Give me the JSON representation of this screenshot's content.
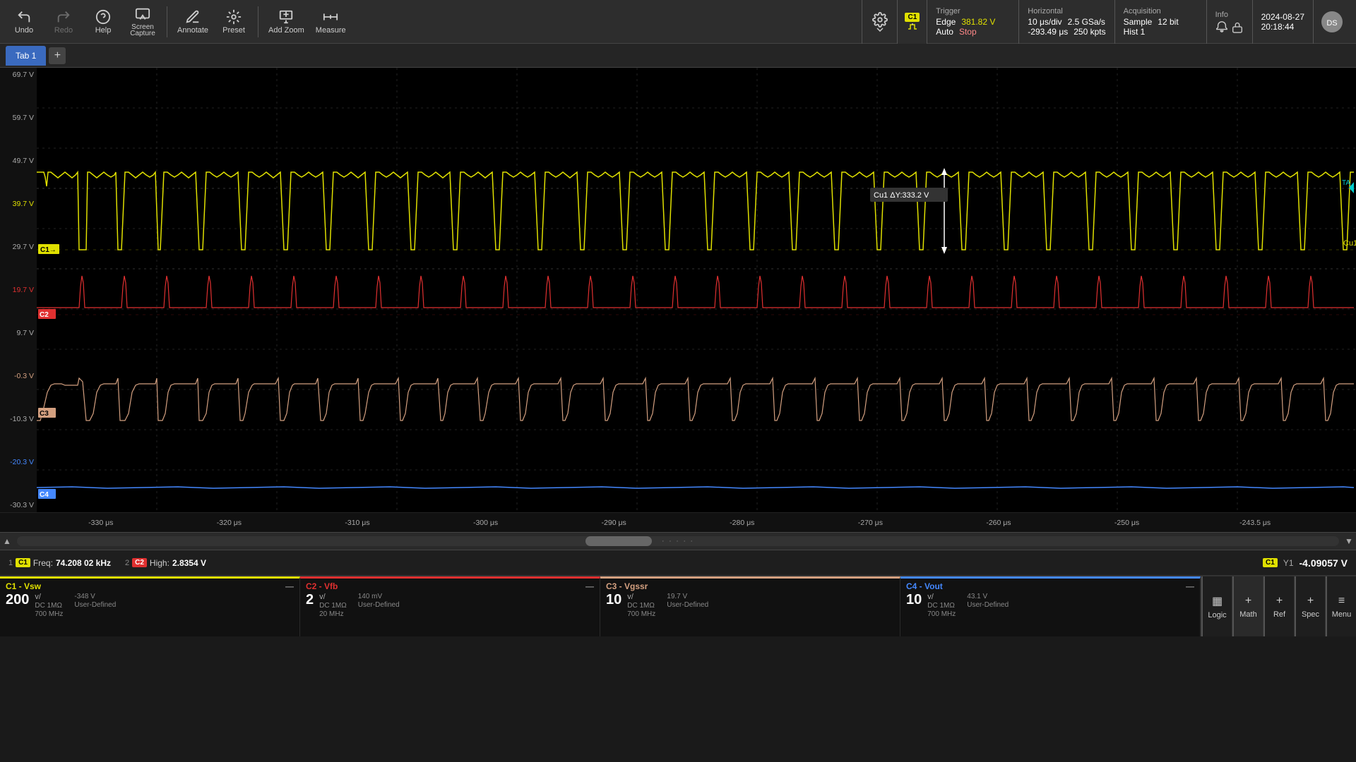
{
  "toolbar": {
    "undo_label": "Undo",
    "redo_label": "Redo",
    "help_label": "Help",
    "screen_capture_label": "Screen\nCapture",
    "annotate_label": "Annotate",
    "preset_label": "Preset",
    "add_zoom_label": "Add Zoom",
    "measure_label": "Measure"
  },
  "trigger": {
    "title": "Trigger",
    "type": "Edge",
    "level": "381.82 V",
    "mode": "Auto",
    "stop": "Stop"
  },
  "horizontal": {
    "title": "Horizontal",
    "timeDiv": "10 μs/div",
    "sampleRate": "2.5 GSa/s",
    "position": "-293.49 μs",
    "points": "250 kpts"
  },
  "acquisition": {
    "title": "Acquisition",
    "mode": "Sample",
    "bits": "12 bit",
    "hist": "Hist 1"
  },
  "info": {
    "title": "Info"
  },
  "datetime": {
    "date": "2024-08-27",
    "time": "20:18:44"
  },
  "tab": {
    "name": "Tab 1"
  },
  "yaxis": {
    "labels": [
      "69.7 V",
      "59.7 V",
      "49.7 V",
      "39.7 V",
      "29.7 V",
      "19.7 V",
      "9.7 V",
      "-0.3 V",
      "-10.3 V",
      "-20.3 V",
      "-30.3 V"
    ]
  },
  "xaxis": {
    "labels": [
      "-330 μs",
      "-320 μs",
      "-310 μs",
      "-300 μs",
      "-290 μs",
      "-280 μs",
      "-270 μs",
      "-260 μs",
      "-250 μs",
      "-243.5 μs"
    ]
  },
  "channels": {
    "c1": {
      "color": "#e0e000",
      "name": "C1",
      "label": "C1 - Vsw",
      "bandwidth": "700 MHz",
      "coupling": "DC 1MΩ",
      "scale": "200 v/",
      "offset": "-348 V",
      "user_defined": "User-Defined"
    },
    "c2": {
      "color": "#e03030",
      "name": "C2",
      "label": "C2 - Vfb",
      "bandwidth": "20 MHz",
      "coupling": "DC 1MΩ",
      "scale": "2 v/",
      "offset": "140 mV",
      "user_defined": "User-Defined"
    },
    "c3": {
      "color": "#d4a080",
      "name": "C3",
      "label": "C3 - Vgssr",
      "bandwidth": "700 MHz",
      "coupling": "DC 1MΩ",
      "scale": "10 v/",
      "offset": "19.7 V",
      "user_defined": "User-Defined"
    },
    "c4": {
      "color": "#4488ff",
      "name": "C4",
      "label": "C4 - Vout",
      "bandwidth": "700 MHz",
      "coupling": "DC 1MΩ",
      "scale": "10 v/",
      "offset": "43.1 V",
      "user_defined": "User-Defined"
    }
  },
  "measurements": {
    "item1_num": "1",
    "item1_ch": "C1",
    "item1_label": "Freq:",
    "item1_value": "74.208 02 kHz",
    "item2_num": "2",
    "item2_ch": "C2",
    "item2_label": "High:",
    "item2_value": "2.8354 V"
  },
  "y1_readout": {
    "ch": "C1",
    "label": "Y1",
    "value": "-4.09057 V"
  },
  "annotation": {
    "delta_y": "Cu1 ΔY:333.2 V"
  },
  "bottom_buttons": {
    "logic": "Logic",
    "math": "Math",
    "ref": "Ref",
    "spec": "Spec",
    "menu": "Menu"
  }
}
